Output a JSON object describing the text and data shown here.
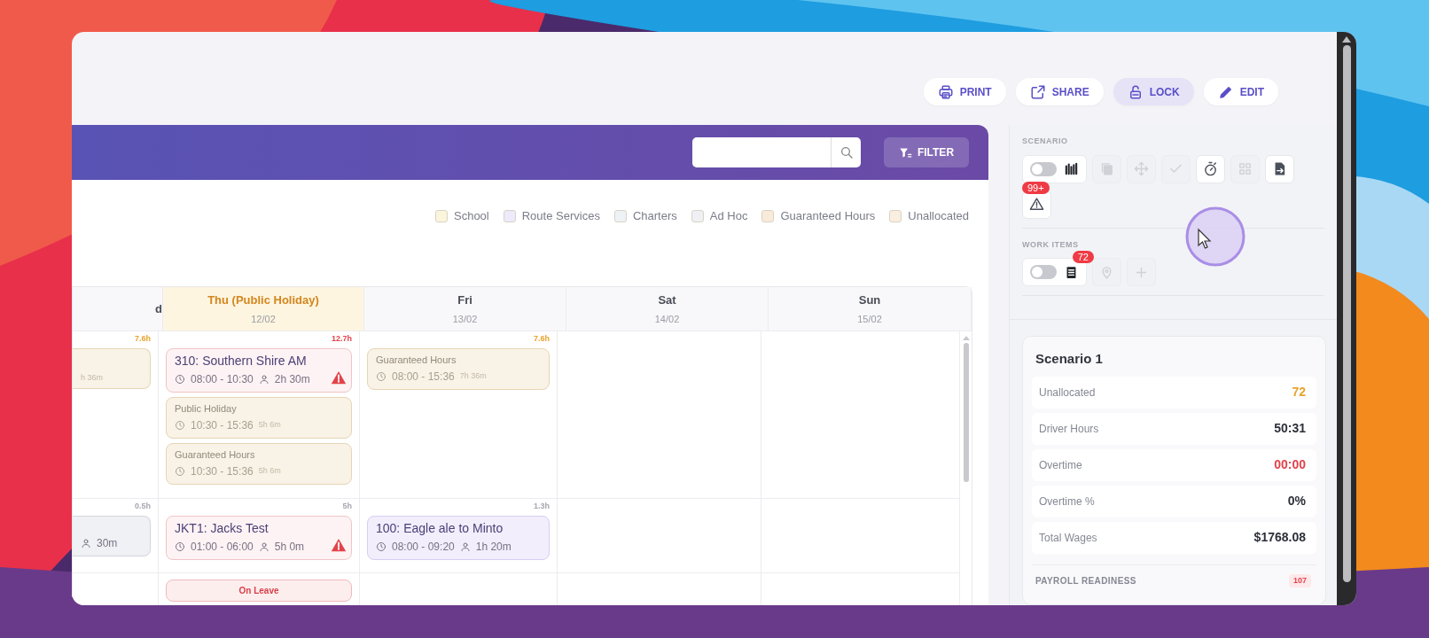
{
  "toolbar": [
    {
      "kind": "print",
      "label": "PRINT",
      "selected": false
    },
    {
      "kind": "share",
      "label": "SHARE",
      "selected": false
    },
    {
      "kind": "lock",
      "label": "LOCK",
      "selected": true
    },
    {
      "kind": "edit",
      "label": "EDIT",
      "selected": false
    }
  ],
  "filter_button": {
    "label": "FILTER"
  },
  "legend": [
    {
      "label": "School",
      "color": "#fbf5dc"
    },
    {
      "label": "Route Services",
      "color": "#eeeafb"
    },
    {
      "label": "Charters",
      "color": "#eef2f7"
    },
    {
      "label": "Ad Hoc",
      "color": "#eef0f4"
    },
    {
      "label": "Guaranteed Hours",
      "color": "#f8ebd9"
    },
    {
      "label": "Unallocated",
      "color": "#f9eedf"
    }
  ],
  "calendar": {
    "days": [
      {
        "name": "d",
        "holiday": false
      },
      {
        "name": "Thu (Public Holiday)",
        "date": "12/02",
        "holiday": true
      },
      {
        "name": "Fri",
        "date": "13/02",
        "holiday": false
      },
      {
        "name": "Sat",
        "date": "14/02",
        "holiday": false
      },
      {
        "name": "Sun",
        "date": "15/02",
        "holiday": false
      }
    ],
    "rows": [
      {
        "cells": [
          {
            "hours": {
              "text": "7.6h",
              "color": "#e7a42c"
            },
            "items": [
              {
                "kind": "guaranteed",
                "duration": "h 36m",
                "alert": false
              }
            ]
          },
          {
            "hours": {
              "text": "12.7h",
              "color": "#e2434b"
            },
            "items": [
              {
                "kind": "trip",
                "title": "310: Southern Shire AM",
                "time": "08:00 - 10:30",
                "duration": "2h 30m",
                "alert": true
              },
              {
                "kind": "guaranteed",
                "title": "Public Holiday",
                "time": "10:30 - 15:36",
                "duration": "5h 6m",
                "alert": false
              },
              {
                "kind": "guaranteed",
                "title": "Guaranteed Hours",
                "time": "10:30 - 15:36",
                "duration": "5h 6m",
                "alert": false
              }
            ]
          },
          {
            "hours": {
              "text": "7.6h",
              "color": "#e7a42c"
            },
            "items": [
              {
                "kind": "guaranteed",
                "title": "Guaranteed Hours",
                "time": "08:00 - 15:36",
                "duration": "7h 36m",
                "alert": false
              }
            ]
          },
          {},
          {}
        ]
      },
      {
        "cells": [
          {
            "hours": {
              "text": "0.5h",
              "color": "#a6a8b0"
            },
            "items": [
              {
                "kind": "adhoc",
                "duration": "30m",
                "alert": false
              }
            ]
          },
          {
            "hours": {
              "text": "5h",
              "color": "#a6a8b0"
            },
            "items": [
              {
                "kind": "trip",
                "title": "JKT1: Jacks Test",
                "time": "01:00 - 06:00",
                "duration": "5h 0m",
                "alert": true
              }
            ]
          },
          {
            "hours": {
              "text": "1.3h",
              "color": "#a6a8b0"
            },
            "items": [
              {
                "kind": "route",
                "title": "100: Eagle ale to Minto",
                "time": "08:00 - 09:20",
                "duration": "1h 20m",
                "alert": false
              }
            ]
          },
          {},
          {}
        ]
      },
      {
        "cells": [
          {},
          {
            "items": [
              {
                "kind": "leave",
                "title": "On Leave",
                "alert": false
              }
            ]
          },
          {},
          {},
          {}
        ]
      }
    ]
  },
  "scenario": {
    "label": "SCENARIO",
    "toggle_on": false,
    "tools": [
      {
        "kind": "copy",
        "enabled": false
      },
      {
        "kind": "move",
        "enabled": false
      },
      {
        "kind": "check",
        "enabled": false
      },
      {
        "kind": "timer",
        "enabled": true
      },
      {
        "kind": "grid",
        "enabled": false
      },
      {
        "kind": "export",
        "enabled": true
      }
    ],
    "alerts_badge": "99+"
  },
  "work_items": {
    "label": "WORK ITEMS",
    "toggle_on": false,
    "badge": "72",
    "tools": [
      {
        "kind": "pin",
        "enabled": false
      },
      {
        "kind": "add",
        "enabled": false
      }
    ]
  },
  "summary": {
    "title": "Scenario 1",
    "stats": [
      {
        "label": "Unallocated",
        "value": "72",
        "color": "#e7a42c"
      },
      {
        "label": "Driver Hours",
        "value": "50:31",
        "color": "#2d303a"
      },
      {
        "label": "Overtime",
        "value": "00:00",
        "color": "#e2434b"
      },
      {
        "label": "Overtime %",
        "value": "0%",
        "color": "#2d303a"
      },
      {
        "label": "Total Wages",
        "value": "$1768.08",
        "color": "#2d303a"
      }
    ],
    "payroll": {
      "label": "PAYROLL READINESS",
      "count": "107"
    }
  }
}
